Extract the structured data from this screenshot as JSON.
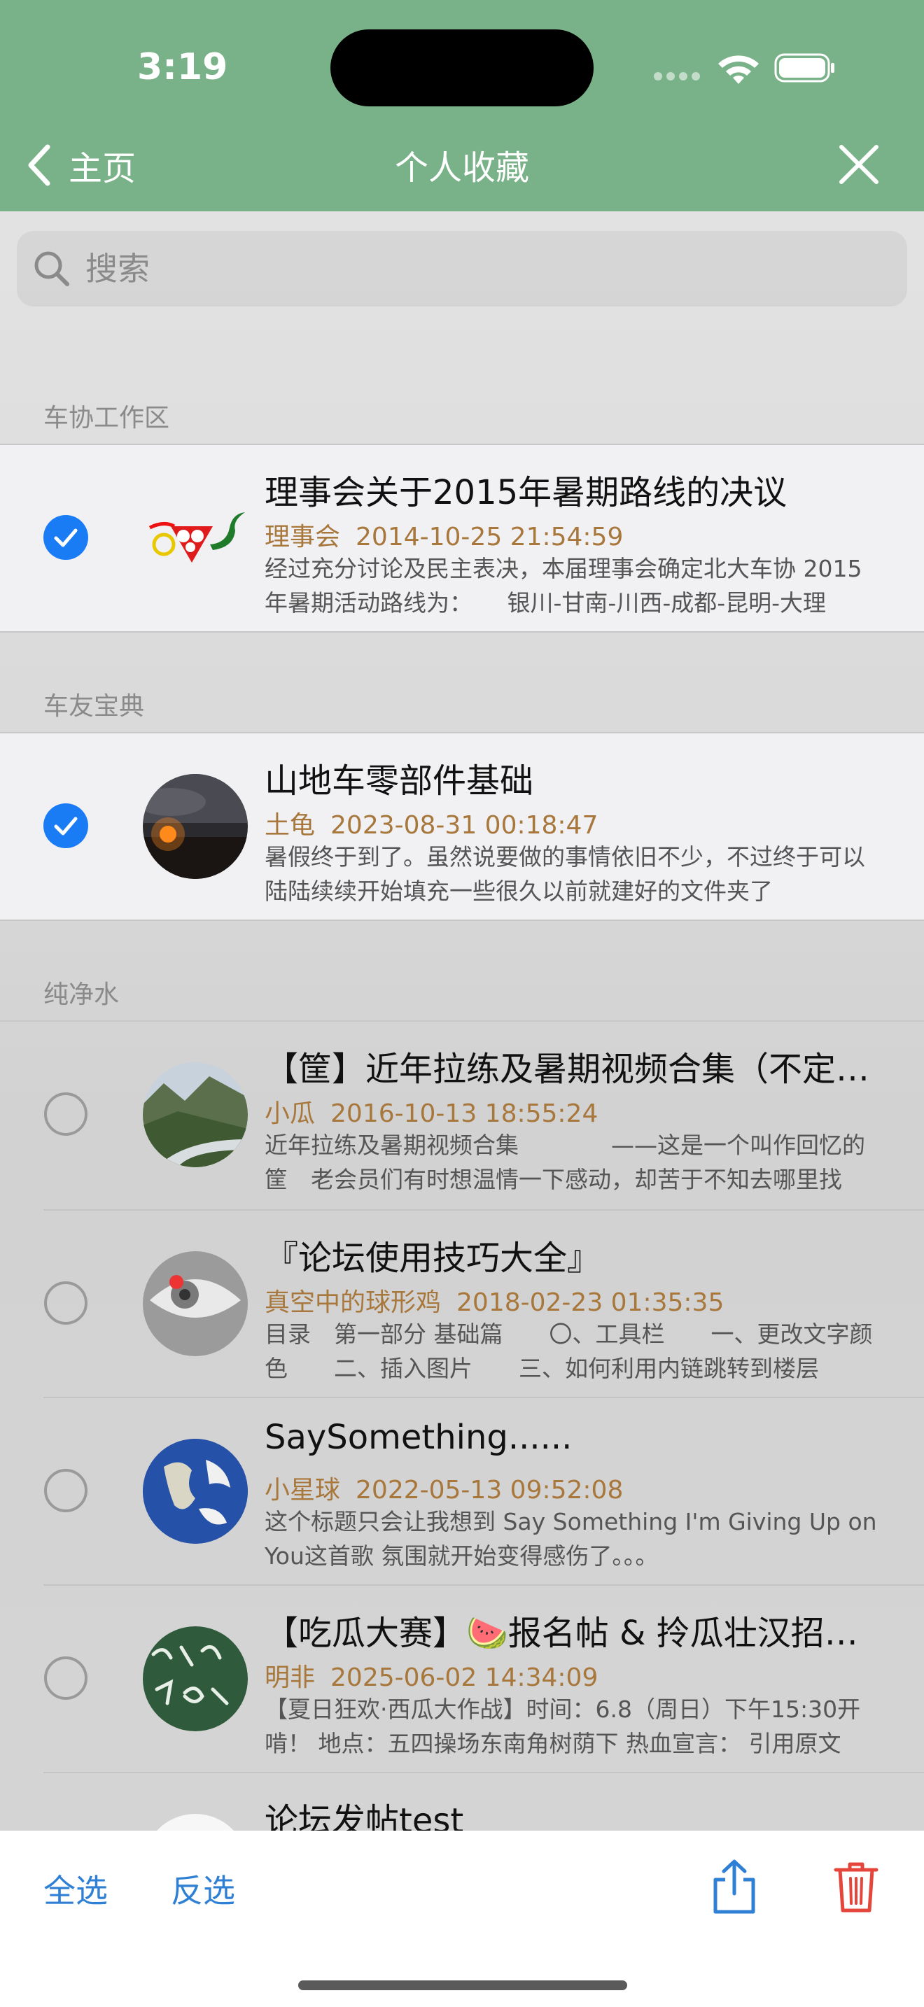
{
  "status_bar": {
    "time": "3:19"
  },
  "nav": {
    "back_label": "主页",
    "title": "个人收藏"
  },
  "search": {
    "placeholder": "搜索"
  },
  "sections": [
    {
      "title": "车协工作区",
      "items": [
        {
          "title": "理事会关于2015年暑期路线的决议",
          "author": "理事会",
          "date": "2014-10-25 21:54:59",
          "preview": "经过充分讨论及民主表决，本届理事会确定北大车协 2015年暑期活动路线为：　　银川-甘南-川西-成都-昆明-大理",
          "checked": true
        }
      ]
    },
    {
      "title": "车友宝典",
      "items": [
        {
          "title": "山地车零部件基础",
          "author": "土龟",
          "date": "2023-08-31 00:18:47",
          "preview": "暑假终于到了。虽然说要做的事情依旧不少，不过终于可以陆陆续续开始填充一些很久以前就建好的文件夹了",
          "checked": true
        }
      ]
    },
    {
      "title": "纯净水",
      "items": [
        {
          "title": "【筐】近年拉练及暑期视频合集（不定期更新）",
          "author": "小瓜",
          "date": "2016-10-13 18:55:24",
          "preview": "近年拉练及暑期视频合集　　　　——这是一个叫作回忆的筐　老会员们有时想温情一下感动，却苦于不知去哪里找",
          "checked": false
        },
        {
          "title": "『论坛使用技巧大全』",
          "author": "真空中的球形鸡",
          "date": "2018-02-23 01:35:35",
          "preview": "目录　第一部分 基础篇　　〇、工具栏　　一、更改文字颜色　　二、插入图片　　三、如何利用内链跳转到楼层",
          "checked": false
        },
        {
          "title": "SaySomething......",
          "author": "小星球",
          "date": "2022-05-13 09:52:08",
          "preview": "这个标题只会让我想到 Say Something I'm Giving Up on You这首歌 氛围就开始变得感伤了。。。",
          "checked": false
        },
        {
          "title": "【吃瓜大赛】🍉报名帖 & 拎瓜壮汉招募令",
          "author": "明非",
          "date": "2025-06-02 14:34:09",
          "preview": "【夏日狂欢·西瓜大作战】时间：6.8（周日）下午15:30开啃！ 地点：五四操场东南角树荫下 热血宣言： 引用原文",
          "checked": false
        },
        {
          "title": "论坛发帖test",
          "author": "",
          "date": "",
          "preview": "",
          "checked": false
        }
      ]
    }
  ],
  "toolbar": {
    "select_all": "全选",
    "invert": "反选"
  },
  "colors": {
    "nav_green": "#79b288",
    "accent_blue": "#2f7fd4",
    "meta_brown": "#a8773b",
    "delete_red": "#e5463b"
  }
}
